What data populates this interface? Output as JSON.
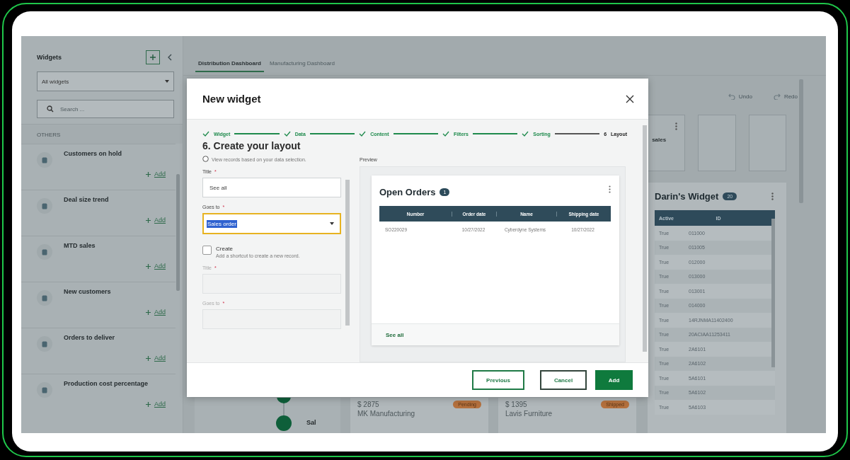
{
  "sidebar": {
    "title": "Widgets",
    "filter": {
      "value": "All widgets"
    },
    "search": {
      "placeholder": "Search ..."
    },
    "section": "OTHERS",
    "items": [
      {
        "name": "Customers on hold",
        "action": "Add"
      },
      {
        "name": "Deal size trend",
        "action": "Add"
      },
      {
        "name": "MTD sales",
        "action": "Add"
      },
      {
        "name": "New customers",
        "action": "Add"
      },
      {
        "name": "Orders to deliver",
        "action": "Add"
      },
      {
        "name": "Production cost percentage",
        "action": "Add"
      }
    ]
  },
  "tabs": [
    {
      "label": "Distribution Dashboard",
      "selected": true
    },
    {
      "label": "Manufacturing Dashboard",
      "selected": false
    }
  ],
  "toolbar": {
    "undo": "Undo",
    "redo": "Redo"
  },
  "dashboard": {
    "sales_card": {
      "title": "sales"
    },
    "timeline": {
      "label": "Sal"
    },
    "order_cards": [
      {
        "amount": "$ 2875",
        "customer": "MK Manufacturing",
        "status": "Pending"
      },
      {
        "amount": "$ 1395",
        "customer": "Lavis Furniture",
        "status": "Shipped"
      }
    ],
    "darins_widget": {
      "title": "Darin's Widget",
      "count": "20",
      "columns": [
        "Active",
        "ID"
      ],
      "rows": [
        [
          "True",
          "011000"
        ],
        [
          "True",
          "011005"
        ],
        [
          "True",
          "012000"
        ],
        [
          "True",
          "013000"
        ],
        [
          "True",
          "013001"
        ],
        [
          "True",
          "014000"
        ],
        [
          "True",
          "14RJNMA11402400"
        ],
        [
          "True",
          "20ACIAA11253411"
        ],
        [
          "True",
          "2A6101"
        ],
        [
          "True",
          "2A6102"
        ],
        [
          "True",
          "5A6101"
        ],
        [
          "True",
          "5A6102"
        ],
        [
          "True",
          "5A6103"
        ]
      ]
    }
  },
  "dialog": {
    "title": "New widget",
    "steps": [
      {
        "label": "Widget",
        "done": true
      },
      {
        "label": "Data",
        "done": true
      },
      {
        "label": "Content",
        "done": true
      },
      {
        "label": "Filters",
        "done": true
      },
      {
        "label": "Sorting",
        "done": true
      },
      {
        "number": "6",
        "label": "Layout",
        "done": false
      }
    ],
    "heading": "6. Create your layout",
    "radio_description": "View records based on your data selection.",
    "fields": [
      {
        "kind": "text",
        "label": "Title",
        "marker": "*",
        "value": "See all",
        "disabled": false
      },
      {
        "kind": "select",
        "label": "Goes to",
        "marker": "*",
        "value": "Sales order",
        "focused": true,
        "text_selected": true,
        "disabled": false
      },
      {
        "kind": "checkbox",
        "label": "Create",
        "description": "Add a shortcut to create a new record.",
        "checked": false
      },
      {
        "kind": "text",
        "label": "Title",
        "marker": "*",
        "disabled": true
      },
      {
        "kind": "text",
        "label": "Goes to",
        "marker": "*",
        "disabled": true
      }
    ],
    "preview": {
      "label": "Preview",
      "widget": {
        "title": "Open Orders",
        "count": "1",
        "columns": [
          "Number",
          "Order date",
          "Name",
          "Shipping date"
        ],
        "rows": [
          [
            "SO220029",
            "10/27/2022",
            "Cyberdyne Systems",
            "10/27/2022"
          ]
        ],
        "link": "See all"
      }
    },
    "buttons": [
      {
        "label": "Previous",
        "kind": "secondary"
      },
      {
        "label": "Cancel",
        "kind": "secondary"
      },
      {
        "label": "Add",
        "kind": "primary"
      }
    ]
  }
}
